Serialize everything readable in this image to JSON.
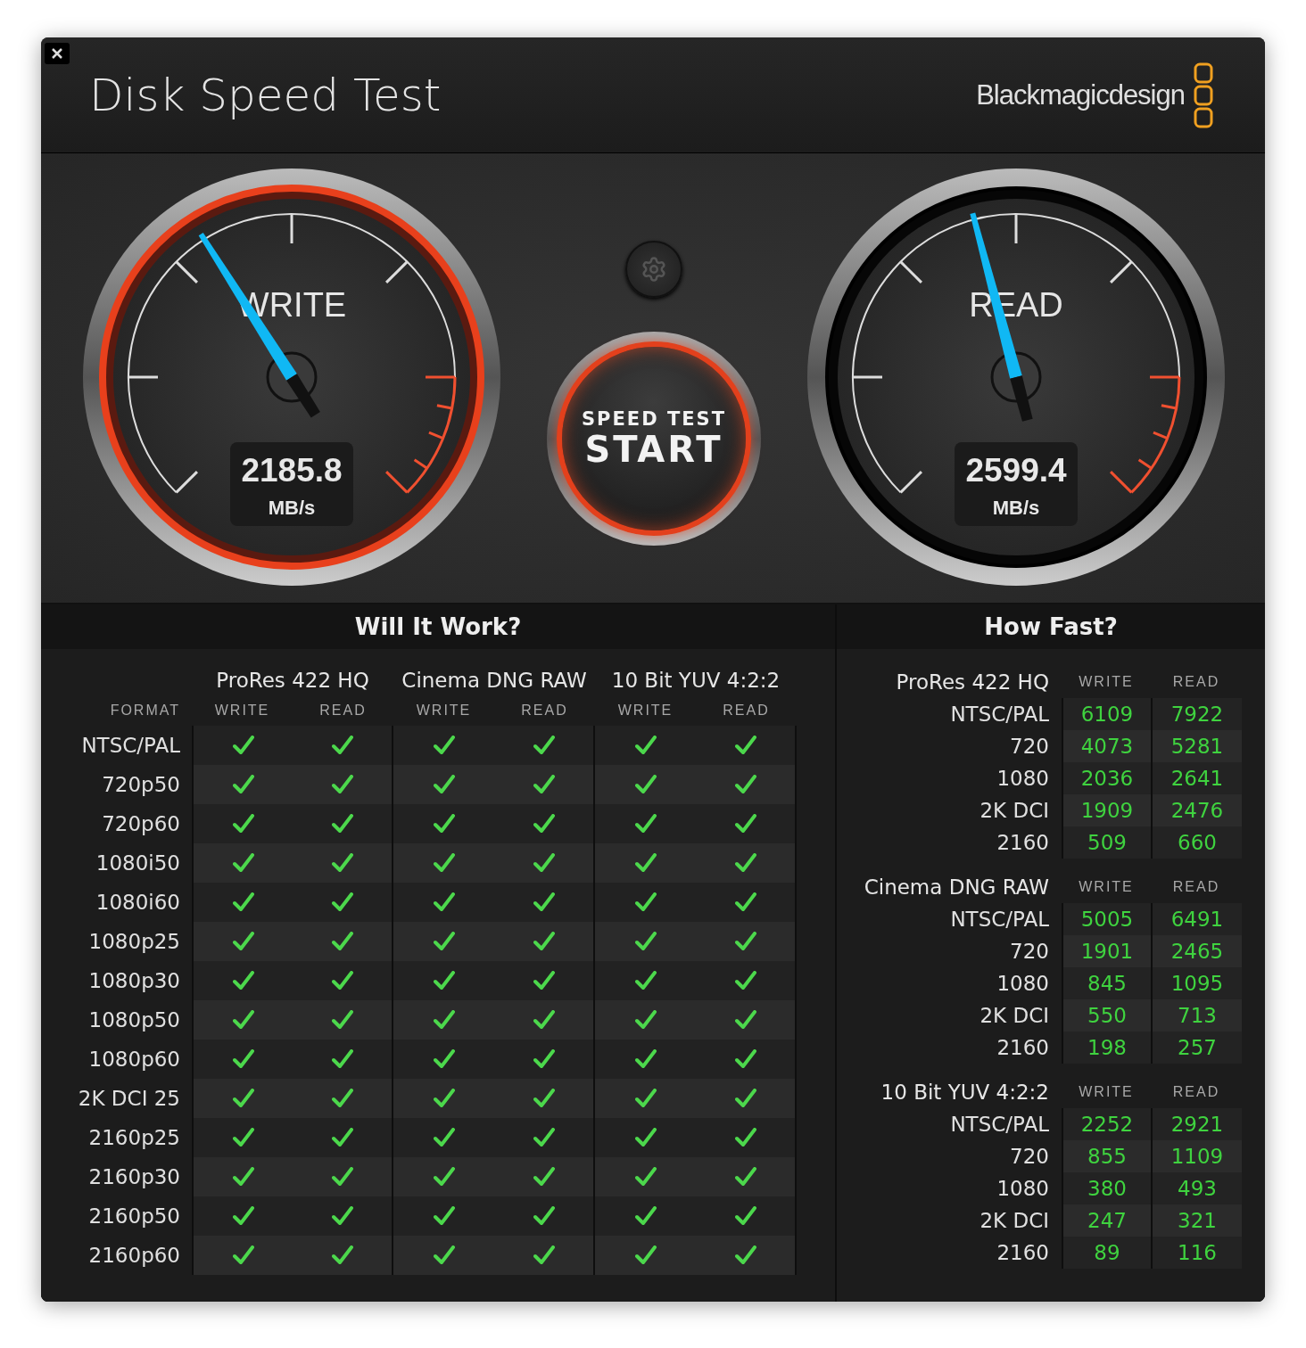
{
  "window": {
    "title": "Disk Speed Test",
    "brand": "Blackmagicdesign"
  },
  "gauges": [
    {
      "label": "WRITE",
      "value": "2185.8",
      "unit": "MB/s",
      "level": 0.38,
      "lit": true
    },
    {
      "label": "READ",
      "value": "2599.4",
      "unit": "MB/s",
      "level": 0.445,
      "lit": false
    }
  ],
  "start_button": {
    "caption": "SPEED TEST",
    "label": "START"
  },
  "will_it_work": {
    "title": "Will It Work?",
    "format_heading": "FORMAT",
    "groups": [
      {
        "name": "ProRes 422 HQ",
        "columns": [
          "WRITE",
          "READ"
        ]
      },
      {
        "name": "Cinema DNG RAW",
        "columns": [
          "WRITE",
          "READ"
        ]
      },
      {
        "name": "10 Bit YUV 4:2:2",
        "columns": [
          "WRITE",
          "READ"
        ]
      }
    ],
    "rows": [
      {
        "format": "NTSC/PAL",
        "checks": [
          true,
          true,
          true,
          true,
          true,
          true
        ]
      },
      {
        "format": "720p50",
        "checks": [
          true,
          true,
          true,
          true,
          true,
          true
        ]
      },
      {
        "format": "720p60",
        "checks": [
          true,
          true,
          true,
          true,
          true,
          true
        ]
      },
      {
        "format": "1080i50",
        "checks": [
          true,
          true,
          true,
          true,
          true,
          true
        ]
      },
      {
        "format": "1080i60",
        "checks": [
          true,
          true,
          true,
          true,
          true,
          true
        ]
      },
      {
        "format": "1080p25",
        "checks": [
          true,
          true,
          true,
          true,
          true,
          true
        ]
      },
      {
        "format": "1080p30",
        "checks": [
          true,
          true,
          true,
          true,
          true,
          true
        ]
      },
      {
        "format": "1080p50",
        "checks": [
          true,
          true,
          true,
          true,
          true,
          true
        ]
      },
      {
        "format": "1080p60",
        "checks": [
          true,
          true,
          true,
          true,
          true,
          true
        ]
      },
      {
        "format": "2K DCI 25",
        "checks": [
          true,
          true,
          true,
          true,
          true,
          true
        ]
      },
      {
        "format": "2160p25",
        "checks": [
          true,
          true,
          true,
          true,
          true,
          true
        ]
      },
      {
        "format": "2160p30",
        "checks": [
          true,
          true,
          true,
          true,
          true,
          true
        ]
      },
      {
        "format": "2160p50",
        "checks": [
          true,
          true,
          true,
          true,
          true,
          true
        ]
      },
      {
        "format": "2160p60",
        "checks": [
          true,
          true,
          true,
          true,
          true,
          true
        ]
      }
    ]
  },
  "how_fast": {
    "title": "How Fast?",
    "sections": [
      {
        "name": "ProRes 422 HQ",
        "columns": [
          "WRITE",
          "READ"
        ],
        "rows": [
          {
            "format": "NTSC/PAL",
            "write": "6109",
            "read": "7922"
          },
          {
            "format": "720",
            "write": "4073",
            "read": "5281"
          },
          {
            "format": "1080",
            "write": "2036",
            "read": "2641"
          },
          {
            "format": "2K DCI",
            "write": "1909",
            "read": "2476"
          },
          {
            "format": "2160",
            "write": "509",
            "read": "660"
          }
        ]
      },
      {
        "name": "Cinema DNG RAW",
        "columns": [
          "WRITE",
          "READ"
        ],
        "rows": [
          {
            "format": "NTSC/PAL",
            "write": "5005",
            "read": "6491"
          },
          {
            "format": "720",
            "write": "1901",
            "read": "2465"
          },
          {
            "format": "1080",
            "write": "845",
            "read": "1095"
          },
          {
            "format": "2K DCI",
            "write": "550",
            "read": "713"
          },
          {
            "format": "2160",
            "write": "198",
            "read": "257"
          }
        ]
      },
      {
        "name": "10 Bit YUV 4:2:2",
        "columns": [
          "WRITE",
          "READ"
        ],
        "rows": [
          {
            "format": "NTSC/PAL",
            "write": "2252",
            "read": "2921"
          },
          {
            "format": "720",
            "write": "855",
            "read": "1109"
          },
          {
            "format": "1080",
            "write": "380",
            "read": "493"
          },
          {
            "format": "2K DCI",
            "write": "247",
            "read": "321"
          },
          {
            "format": "2160",
            "write": "89",
            "read": "116"
          }
        ]
      }
    ]
  }
}
